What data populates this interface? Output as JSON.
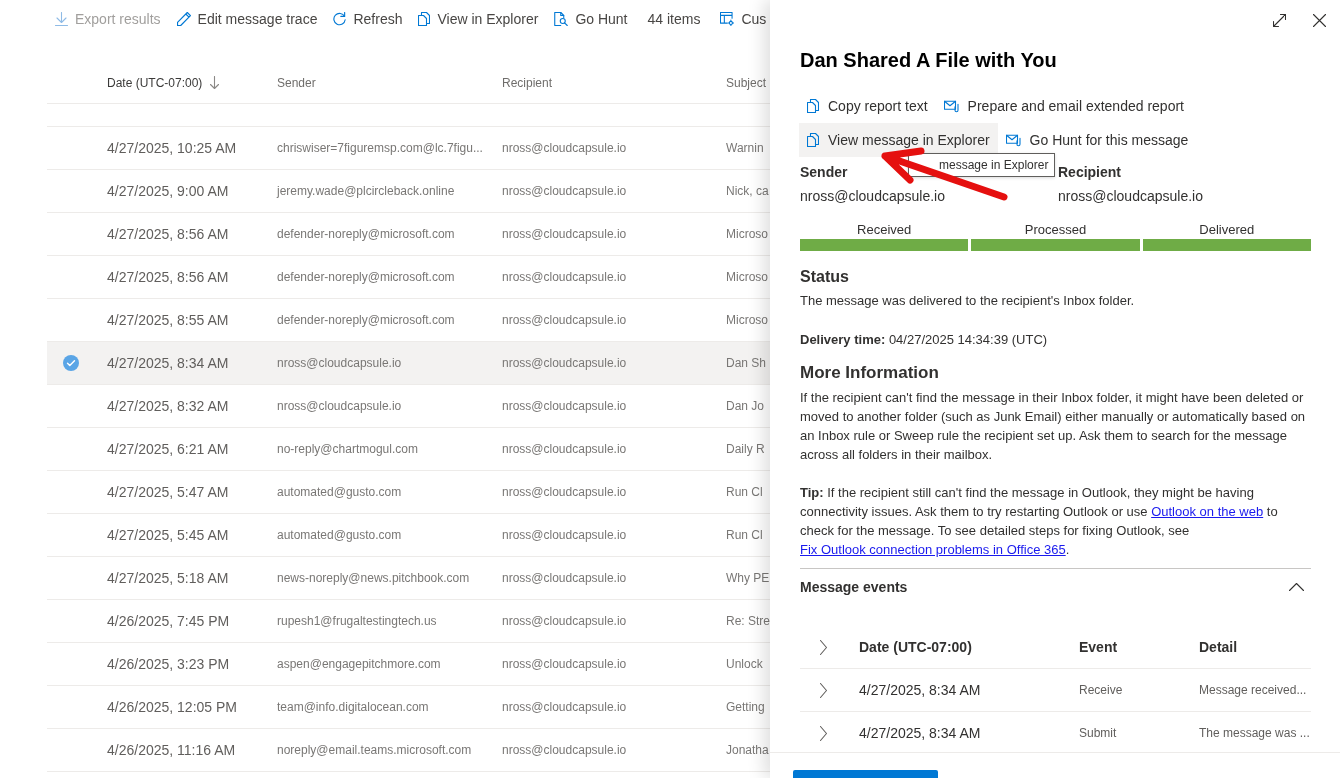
{
  "toolbar": [
    {
      "kind": "button",
      "label": "Export results",
      "disabled": true
    },
    {
      "kind": "button",
      "label": "Edit message trace",
      "disabled": false
    },
    {
      "kind": "button",
      "label": "Refresh",
      "disabled": false
    },
    {
      "kind": "button",
      "label": "View in Explorer",
      "disabled": false
    },
    {
      "kind": "button",
      "label": "Go Hunt",
      "disabled": false
    },
    {
      "kind": "count",
      "label": "44 items"
    },
    {
      "kind": "button",
      "label": "Cus",
      "disabled": false
    }
  ],
  "table": {
    "columns": [
      {
        "label": "Date (UTC-07:00)",
        "sorted": true
      },
      {
        "label": "Sender",
        "sorted": false
      },
      {
        "label": "Recipient",
        "sorted": false
      },
      {
        "label": "Subject",
        "sorted": false
      }
    ],
    "rows": [
      {
        "date": "4/27/2025, 10:25 AM",
        "sender": "chriswiser=7figuremsp.com@lc.7figu...",
        "recipient": "nross@cloudcapsule.io",
        "subject": "Warnin",
        "selected": false
      },
      {
        "date": "4/27/2025, 9:00 AM",
        "sender": "jeremy.wade@plcircleback.online",
        "recipient": "nross@cloudcapsule.io",
        "subject": "Nick, ca",
        "selected": false
      },
      {
        "date": "4/27/2025, 8:56 AM",
        "sender": "defender-noreply@microsoft.com",
        "recipient": "nross@cloudcapsule.io",
        "subject": "Microso",
        "selected": false
      },
      {
        "date": "4/27/2025, 8:56 AM",
        "sender": "defender-noreply@microsoft.com",
        "recipient": "nross@cloudcapsule.io",
        "subject": "Microso",
        "selected": false
      },
      {
        "date": "4/27/2025, 8:55 AM",
        "sender": "defender-noreply@microsoft.com",
        "recipient": "nross@cloudcapsule.io",
        "subject": "Microso",
        "selected": false
      },
      {
        "date": "4/27/2025, 8:34 AM",
        "sender": "nross@cloudcapsule.io",
        "recipient": "nross@cloudcapsule.io",
        "subject": "Dan Sh",
        "selected": true
      },
      {
        "date": "4/27/2025, 8:32 AM",
        "sender": "nross@cloudcapsule.io",
        "recipient": "nross@cloudcapsule.io",
        "subject": "Dan Jo",
        "selected": false
      },
      {
        "date": "4/27/2025, 6:21 AM",
        "sender": "no-reply@chartmogul.com",
        "recipient": "nross@cloudcapsule.io",
        "subject": "Daily R",
        "selected": false
      },
      {
        "date": "4/27/2025, 5:47 AM",
        "sender": "automated@gusto.com",
        "recipient": "nross@cloudcapsule.io",
        "subject": "Run Cl",
        "selected": false
      },
      {
        "date": "4/27/2025, 5:45 AM",
        "sender": "automated@gusto.com",
        "recipient": "nross@cloudcapsule.io",
        "subject": "Run Cl",
        "selected": false
      },
      {
        "date": "4/27/2025, 5:18 AM",
        "sender": "news-noreply@news.pitchbook.com",
        "recipient": "nross@cloudcapsule.io",
        "subject": "Why PE",
        "selected": false
      },
      {
        "date": "4/26/2025, 7:45 PM",
        "sender": "rupesh1@frugaltestingtech.us",
        "recipient": "nross@cloudcapsule.io",
        "subject": "Re: Stre",
        "selected": false
      },
      {
        "date": "4/26/2025, 3:23 PM",
        "sender": "aspen@engagepitchmore.com",
        "recipient": "nross@cloudcapsule.io",
        "subject": "Unlock",
        "selected": false
      },
      {
        "date": "4/26/2025, 12:05 PM",
        "sender": "team@info.digitalocean.com",
        "recipient": "nross@cloudcapsule.io",
        "subject": "Getting",
        "selected": false
      },
      {
        "date": "4/26/2025, 11:16 AM",
        "sender": "noreply@email.teams.microsoft.com",
        "recipient": "nross@cloudcapsule.io",
        "subject": "Jonatha",
        "selected": false
      }
    ]
  },
  "panel": {
    "title": "Dan Shared A File with You",
    "actions": [
      {
        "label": "Copy report text",
        "hovered": false
      },
      {
        "label": "Prepare and email extended report",
        "hovered": false
      },
      {
        "label": "View message in Explorer",
        "hovered": true
      },
      {
        "label": "Go Hunt for this message",
        "hovered": false
      }
    ],
    "tooltip": "message in Explorer",
    "sender": {
      "label": "Sender",
      "value": "nross@cloudcapsule.io"
    },
    "recipient": {
      "label": "Recipient",
      "value": "nross@cloudcapsule.io"
    },
    "steps": [
      {
        "label": "Received",
        "completed": true
      },
      {
        "label": "Processed",
        "completed": true
      },
      {
        "label": "Delivered",
        "completed": true
      }
    ],
    "status": {
      "heading": "Status",
      "text": "The message was delivered to the recipient's Inbox folder."
    },
    "delivery_time": "**Delivery time:** 04/27/2025 14:34:39 (UTC)",
    "more_information": {
      "heading": "More Information",
      "text": "If the recipient can't find the message in their Inbox folder, it might have been deleted or moved to another folder (such as Junk Email) either manually or automatically based on an Inbox rule or Sweep rule the recipient set up. Ask them to search for the message across all folders in their mailbox.",
      "tip": [
        {
          "kind": "text",
          "text": "**Tip:** If the recipient still can't find the message in Outlook, they might be having connectivity issues. Ask them to try restarting Outlook or use "
        },
        {
          "kind": "link",
          "text": "Outlook on the web"
        },
        {
          "kind": "text",
          "text": " to check for the message. To see detailed steps for fixing Outlook, see "
        },
        {
          "kind": "link",
          "text": "Fix Outlook connection problems in Office 365"
        },
        {
          "kind": "text",
          "text": "."
        }
      ]
    },
    "message_events": {
      "heading": "Message events",
      "expanded": true,
      "columns": [
        "Date (UTC-07:00)",
        "Event",
        "Detail"
      ],
      "rows": [
        {
          "date": "4/27/2025, 8:34 AM",
          "event": "Receive",
          "detail": "Message received...",
          "expanded": false
        },
        {
          "date": "4/27/2025, 8:34 AM",
          "event": "Submit",
          "detail": "The message was ...",
          "expanded": false
        }
      ]
    }
  }
}
